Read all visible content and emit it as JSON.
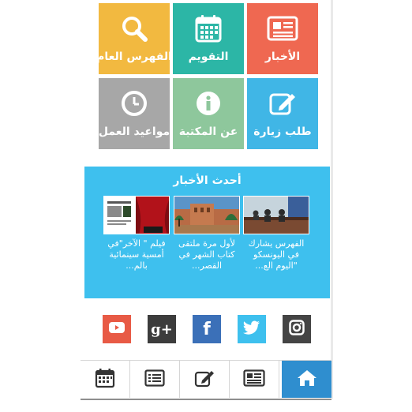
{
  "colors": {
    "news": "#ef6851",
    "calendar": "#2cb6a6",
    "catalog": "#f2b940",
    "visit": "#40b6e6",
    "about": "#8ec79c",
    "hours": "#a7a7a7",
    "news_panel": "#3ec0ee",
    "youtube": "#e85a45",
    "gplus": "#3c3c3c",
    "facebook": "#3b70b8",
    "twitter": "#3ec0ee",
    "instagram": "#444444",
    "nav_active": "#2f8ecf"
  },
  "tiles": [
    {
      "label": "الأخبار",
      "icon": "newspaper-icon"
    },
    {
      "label": "التقويم",
      "icon": "calendar-icon"
    },
    {
      "label": "الفهرس العام",
      "icon": "search-icon"
    },
    {
      "label": "طلب زيارة",
      "icon": "edit-icon"
    },
    {
      "label": "عن المكتبة",
      "icon": "info-icon"
    },
    {
      "label": "مواعيد العمل",
      "icon": "clock-icon"
    }
  ],
  "news_section": {
    "title": "أحدث الأخبار",
    "items": [
      {
        "caption": "الفهرس يشارك في اليونسكو \"اليوم الع..."
      },
      {
        "caption": "لأول مرة ملتقى كتاب الشهر في القصر..."
      },
      {
        "caption": "فيلم \" الآخر\"في أمسية سينمائية بالم..."
      }
    ]
  },
  "social": [
    {
      "icon": "youtube-icon"
    },
    {
      "icon": "google-plus-icon",
      "text": "g+"
    },
    {
      "icon": "facebook-icon",
      "text": "f"
    },
    {
      "icon": "twitter-icon"
    },
    {
      "icon": "instagram-icon"
    }
  ],
  "bottom_nav": [
    {
      "icon": "home-icon",
      "active": true
    },
    {
      "icon": "newspaper-icon",
      "active": false
    },
    {
      "icon": "edit-icon",
      "active": false
    },
    {
      "icon": "list-icon",
      "active": false
    },
    {
      "icon": "calendar-icon",
      "active": false
    }
  ]
}
